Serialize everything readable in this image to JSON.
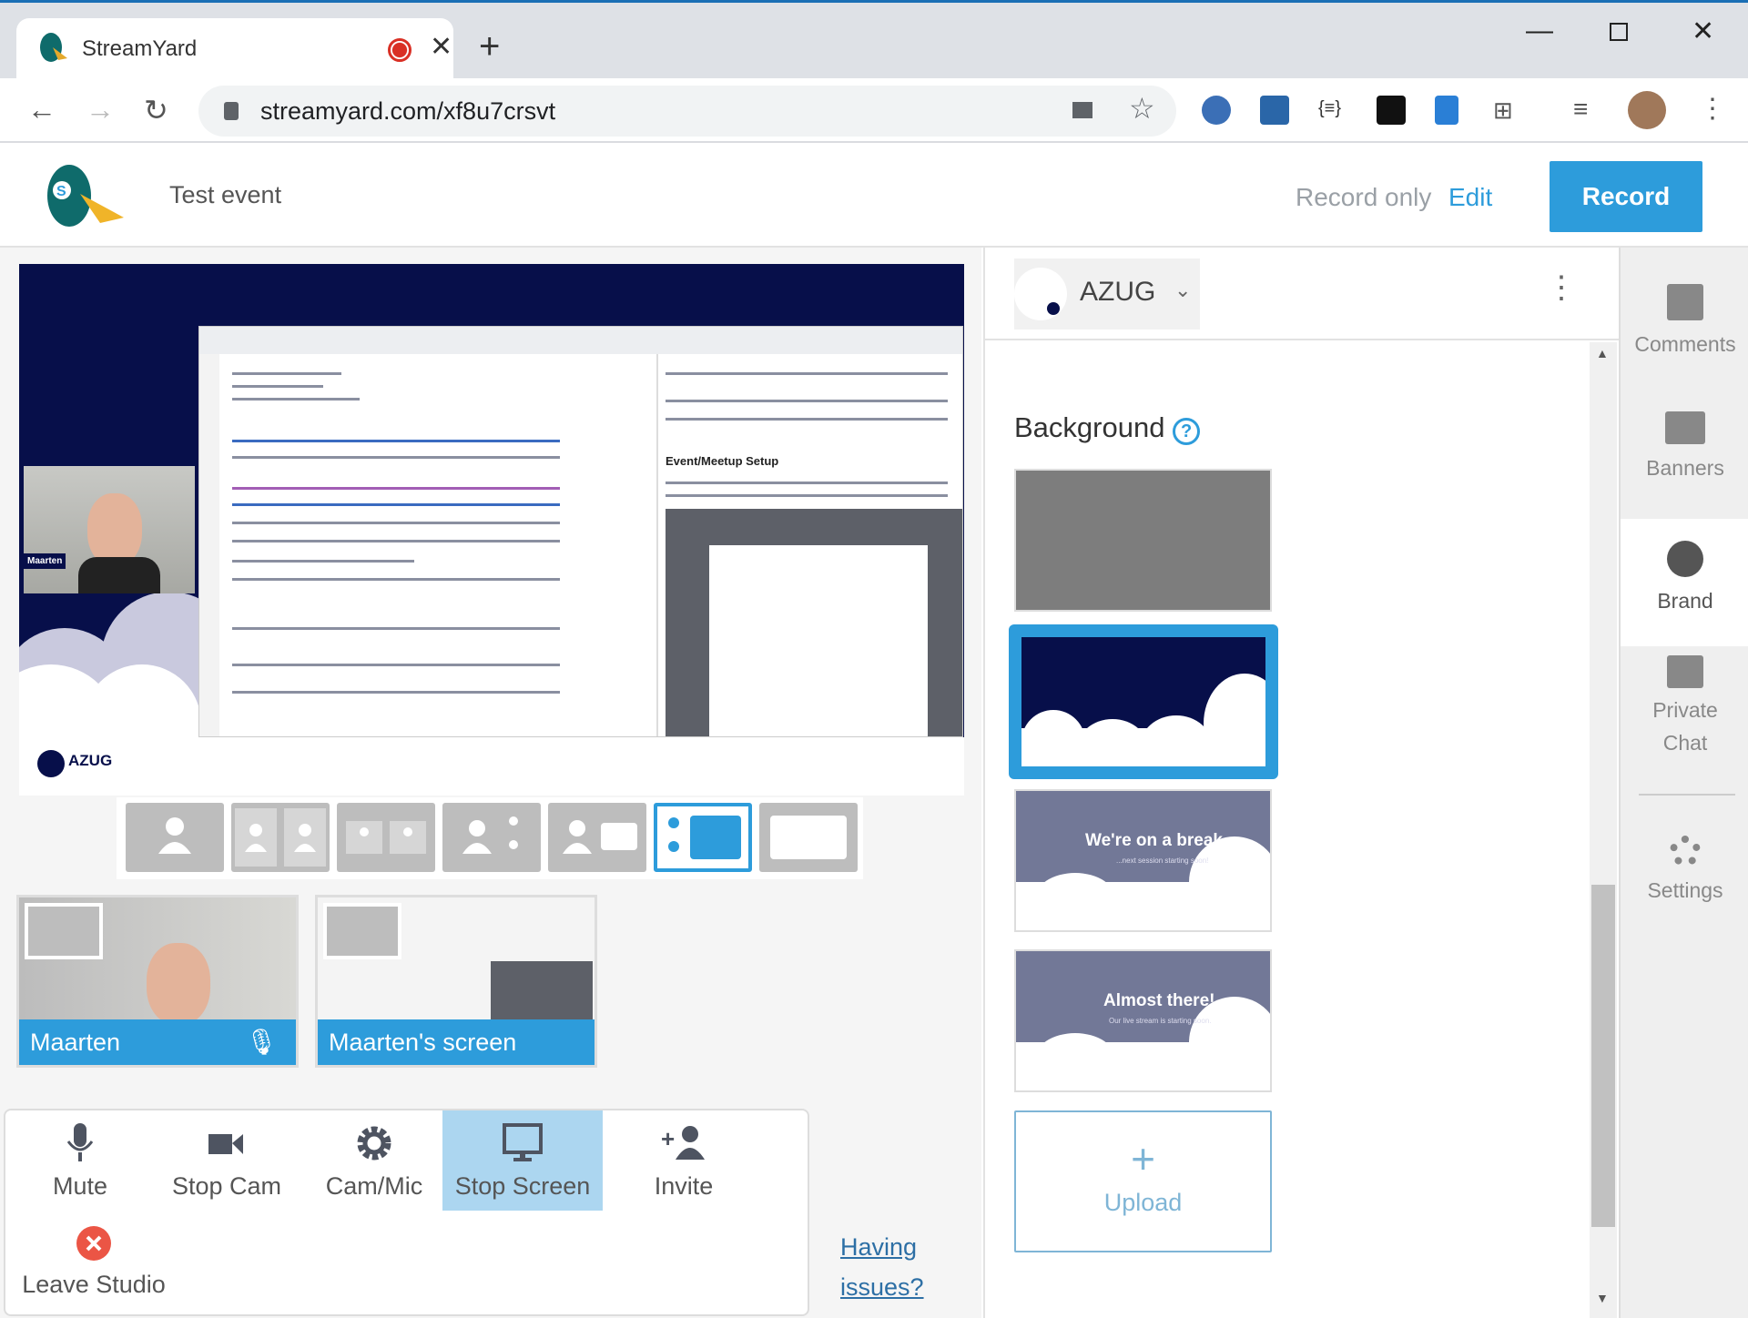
{
  "browser": {
    "tab_title": "StreamYard",
    "url": "streamyard.com/xf8u7crsvt",
    "new_tab": "+"
  },
  "header": {
    "event_title": "Test event",
    "record_only": "Record only",
    "edit": "Edit",
    "record": "Record"
  },
  "stage": {
    "camera_name": "Maarten",
    "logo_text": "AZUG",
    "screen_heading": "Event/Meetup Setup"
  },
  "layouts": [
    "solo",
    "split",
    "thin-split",
    "group",
    "picture-in-picture",
    "sidebar",
    "fullscreen"
  ],
  "selected_layout": 5,
  "participants": [
    {
      "name": "Maarten"
    },
    {
      "name": "Maarten's screen"
    }
  ],
  "controls": {
    "mute": "Mute",
    "stop_cam": "Stop Cam",
    "cam_mic": "Cam/Mic",
    "stop_screen": "Stop Screen",
    "invite": "Invite",
    "leave": "Leave Studio",
    "having_issues_1": "Having",
    "having_issues_2": "issues?"
  },
  "brand_panel": {
    "brand_name": "AZUG",
    "background_title": "Background",
    "help": "?",
    "thumbs": [
      {
        "title": ""
      },
      {
        "title": ""
      },
      {
        "title": "We're on a break...",
        "subtitle": "...next session starting soon!"
      },
      {
        "title": "Almost there!",
        "subtitle": "Our live stream is starting soon."
      }
    ],
    "upload": "Upload",
    "upload_plus": "+"
  },
  "sidebar": {
    "items": [
      {
        "label": "Comments"
      },
      {
        "label": "Banners"
      },
      {
        "label": "Brand"
      },
      {
        "label": "Private",
        "label2": "Chat"
      },
      {
        "label": "Settings"
      }
    ]
  },
  "colors": {
    "accent": "#2d9cdb",
    "stage_bg": "#070f4a",
    "leave": "#eb5545"
  }
}
